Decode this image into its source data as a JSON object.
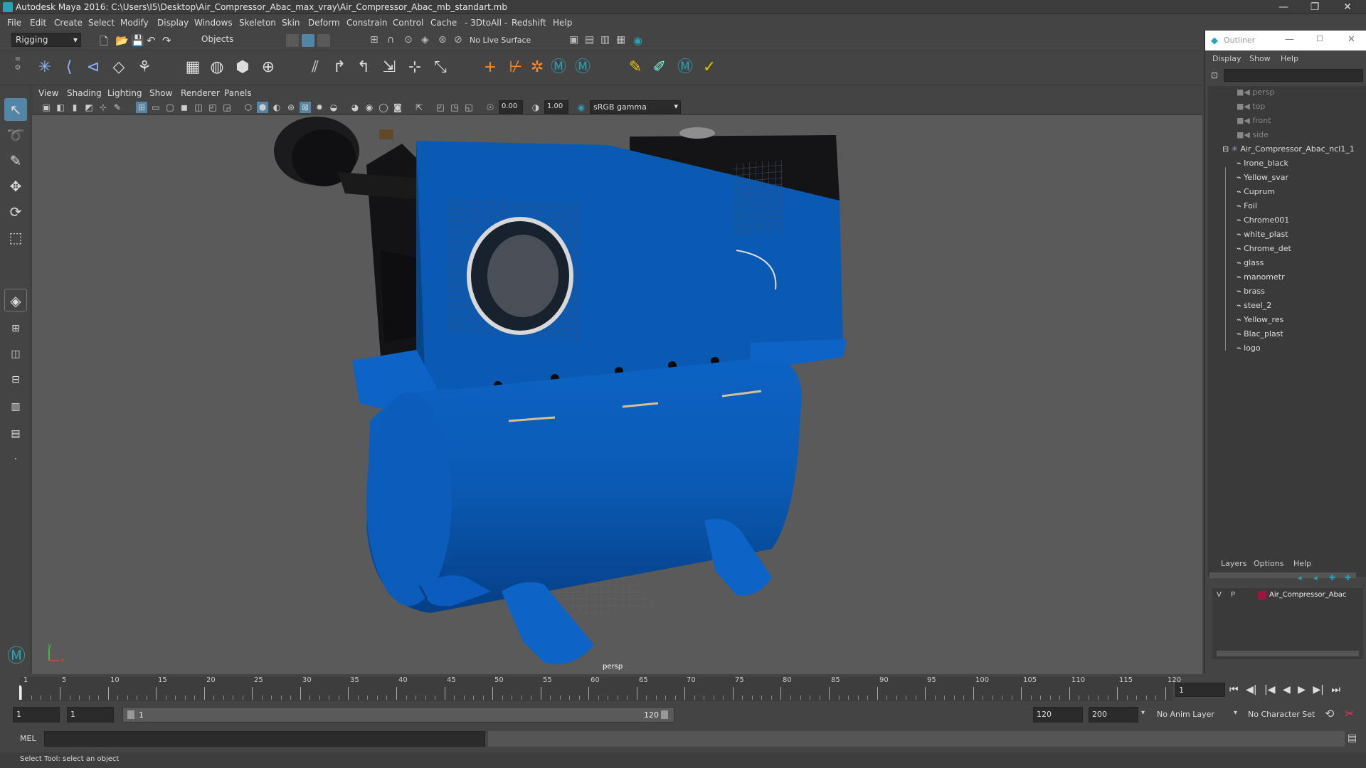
{
  "window": {
    "title": "Autodesk Maya 2016: C:\\Users\\I5\\Desktop\\Air_Compressor_Abac_max_vray\\Air_Compressor_Abac_mb_standart.mb",
    "minimize": "—",
    "restore": "❐",
    "close": "✕"
  },
  "menubar": [
    "File",
    "Edit",
    "Create",
    "Select",
    "Modify",
    "Display",
    "Windows",
    "Skeleton",
    "Skin",
    "Deform",
    "Constrain",
    "Control",
    "Cache",
    "- 3DtoAll -",
    "Redshift",
    "Help"
  ],
  "statusline": {
    "menuset": "Rigging",
    "selection_mode": "Objects",
    "live_surface": "No Live Surface"
  },
  "viewport": {
    "menus": [
      "View",
      "Shading",
      "Lighting",
      "Show",
      "Renderer",
      "Panels"
    ],
    "exposure": "0.00",
    "gamma": "1.00",
    "colorspace": "sRGB gamma",
    "camera_label": "persp",
    "axis_y": "y",
    "axis_x": "x"
  },
  "outliner": {
    "title": "Outliner",
    "menus": [
      "Display",
      "Show",
      "Help"
    ],
    "cameras": [
      "persp",
      "top",
      "front",
      "side"
    ],
    "root": "Air_Compressor_Abac_ncl1_1",
    "children": [
      "Irone_black",
      "Yellow_svar",
      "Cuprum",
      "Foil",
      "Chrome001",
      "white_plast",
      "Chrome_det",
      "glass",
      "manometr",
      "brass",
      "steel_2",
      "Yellow_res",
      "Blac_plast",
      "logo"
    ]
  },
  "layers": {
    "menus": [
      "Layers",
      "Options",
      "Help"
    ],
    "row": {
      "v": "V",
      "p": "P",
      "name": "Air_Compressor_Abac",
      "color": "#a0153e"
    }
  },
  "timeline": {
    "ticks": [
      "1",
      "5",
      "10",
      "15",
      "20",
      "25",
      "30",
      "35",
      "40",
      "45",
      "50",
      "55",
      "60",
      "65",
      "70",
      "75",
      "80",
      "85",
      "90",
      "95",
      "100",
      "105",
      "110",
      "115",
      "120"
    ],
    "current_frame": "1"
  },
  "range": {
    "start": "1",
    "playback_start": "1",
    "slider_start": "1",
    "slider_end": "120",
    "playback_end": "120",
    "end": "200",
    "anim_layer": "No Anim Layer",
    "character_set": "No Character Set"
  },
  "cmdline": {
    "label": "MEL"
  },
  "helpline": {
    "text": "Select Tool: select an object"
  },
  "colors": {
    "accent": "#5285a6",
    "compressor_blue": "#0a5db8",
    "viewport_bg": "#5a5a5a"
  }
}
